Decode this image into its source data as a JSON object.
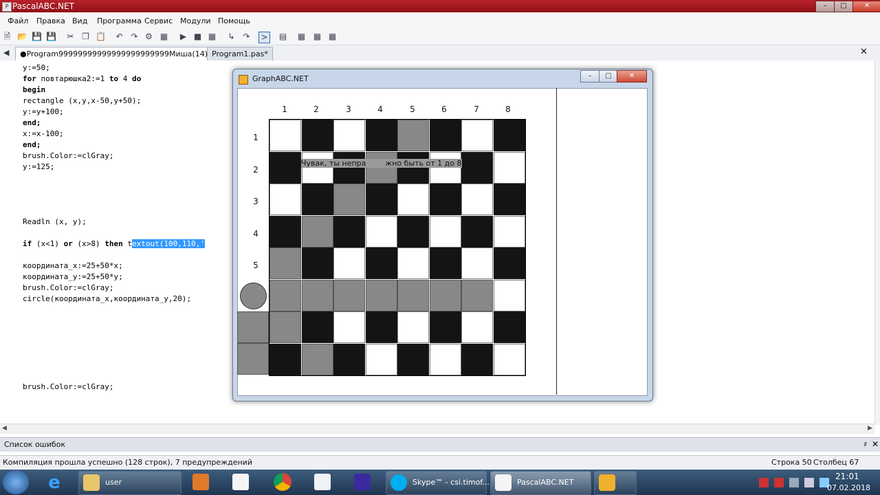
{
  "window": {
    "title": "PascalABC.NET"
  },
  "menu": [
    "Файл",
    "Правка",
    "Вид",
    "Программа",
    "Сервис",
    "Модули",
    "Помощь"
  ],
  "tabs": [
    {
      "label": "●Program99999999999999999999999Миша(14).pas*"
    },
    {
      "label": "Program1.pas*"
    }
  ],
  "code": {
    "l1": "y:=50;",
    "l2a": "for",
    "l2b": " повтарюшка2:=1 ",
    "l2c": "to",
    "l2d": " 4 ",
    "l2e": "do",
    "l3": "begin",
    "l4": "rectangle (x,y,x-50,y+50);",
    "l5": "y:=y+100;",
    "l6": "end;",
    "l7": "x:=x-100;",
    "l8": "end;",
    "l9": "brush.Color:=clGray;",
    "l10": "y:=125;",
    "l11": "Readln (x, y);",
    "l12a": "if",
    "l12b": " (x<1) ",
    "l12c": "or",
    "l12d": " (x>8) ",
    "l12e": "then",
    "l12f": " t",
    "l12g": "extout(100,110,'",
    "l13": "координата_x:=25+50*x;",
    "l14": "координата_y:=25+50*y;",
    "l15": "brush.Color:=clGray;",
    "l16": "circle(координата_x,координата_y,20);",
    "l17": "brush.Color:=clGray;"
  },
  "graph": {
    "title": "GraphABC.NET",
    "col_labels": [
      "1",
      "2",
      "3",
      "4",
      "5",
      "6",
      "7",
      "8"
    ],
    "row_labels": [
      "1",
      "2",
      "3",
      "4",
      "5"
    ],
    "message": "Чувак, ты непра        жно быть от 1 до 8",
    "board": [
      [
        "w",
        "b",
        "w",
        "b",
        "g",
        "b",
        "w",
        "b"
      ],
      [
        "b",
        "w",
        "b",
        "g",
        "b",
        "w",
        "b",
        "w"
      ],
      [
        "w",
        "b",
        "g",
        "b",
        "w",
        "b",
        "w",
        "b"
      ],
      [
        "b",
        "g",
        "b",
        "w",
        "b",
        "w",
        "b",
        "w"
      ],
      [
        "g",
        "b",
        "w",
        "b",
        "w",
        "b",
        "w",
        "b"
      ],
      [
        "g",
        "g",
        "g",
        "g",
        "g",
        "g",
        "g",
        "w"
      ],
      [
        "g",
        "b",
        "w",
        "b",
        "w",
        "b",
        "w",
        "b"
      ],
      [
        "b",
        "g",
        "b",
        "w",
        "b",
        "w",
        "b",
        "w"
      ]
    ]
  },
  "panels": {
    "errors_label": "Список ошибок"
  },
  "status": {
    "compile": "Компиляция прошла успешно (128 строк), 7 предупреждений",
    "row": "Строка  50",
    "col": "Столбец  67"
  },
  "taskbar": {
    "items": [
      "user",
      "Skype™ - csi.timof...",
      "PascalABC.NET"
    ],
    "time": "21:01",
    "date": "07.02.2018"
  }
}
